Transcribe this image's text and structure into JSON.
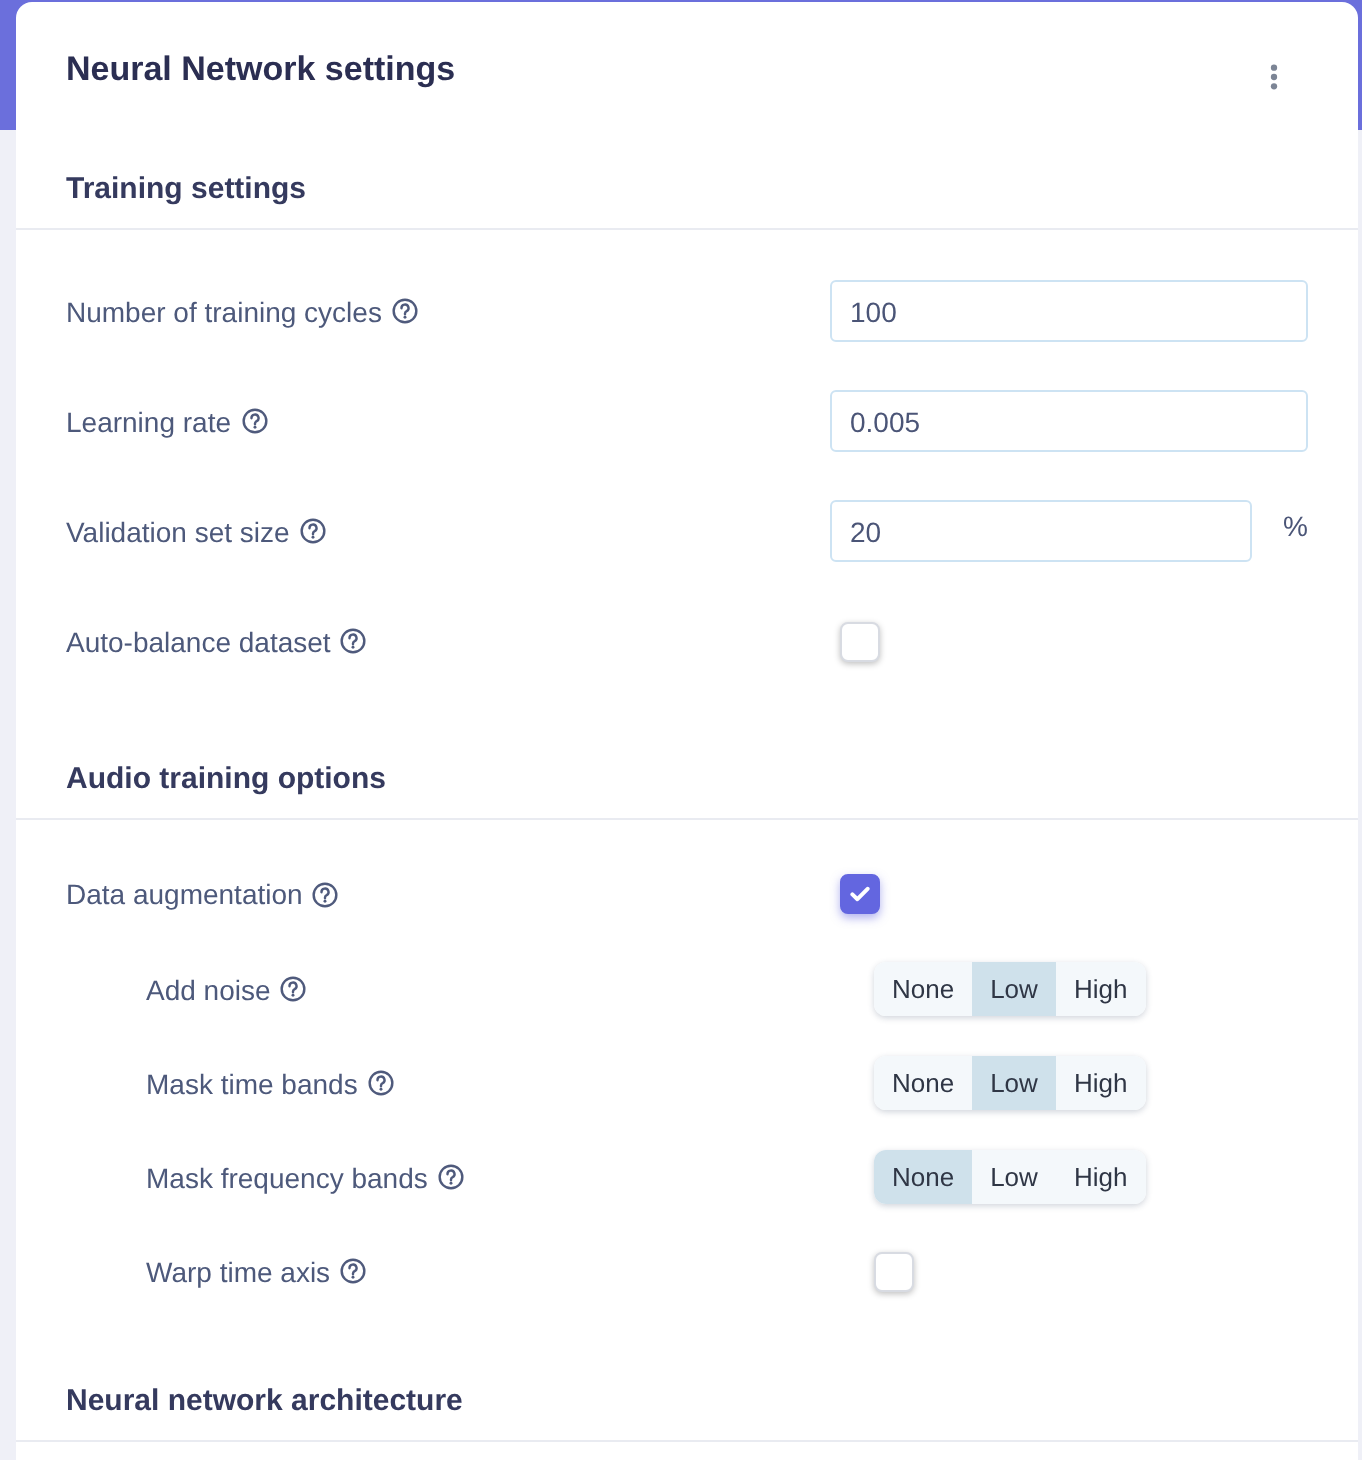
{
  "card": {
    "title": "Neural Network settings"
  },
  "sections": [
    {
      "title": "Training settings",
      "fields": [
        {
          "kind": "number",
          "label": "Number of training cycles",
          "value": "100"
        },
        {
          "kind": "number",
          "label": "Learning rate",
          "value": "0.005"
        },
        {
          "kind": "number",
          "label": "Validation set size",
          "value": "20",
          "unit": "%"
        },
        {
          "kind": "checkbox",
          "label": "Auto-balance dataset",
          "checked": false
        }
      ]
    },
    {
      "title": "Audio training options",
      "fields": [
        {
          "kind": "checkbox",
          "label": "Data augmentation",
          "checked": true,
          "children": [
            {
              "kind": "segmented",
              "label": "Add noise",
              "options": [
                {
                  "label": "None",
                  "selected": false
                },
                {
                  "label": "Low",
                  "selected": true
                },
                {
                  "label": "High",
                  "selected": false
                }
              ]
            },
            {
              "kind": "segmented",
              "label": "Mask time bands",
              "options": [
                {
                  "label": "None",
                  "selected": false
                },
                {
                  "label": "Low",
                  "selected": true
                },
                {
                  "label": "High",
                  "selected": false
                }
              ]
            },
            {
              "kind": "segmented",
              "label": "Mask frequency bands",
              "options": [
                {
                  "label": "None",
                  "selected": true
                },
                {
                  "label": "Low",
                  "selected": false
                },
                {
                  "label": "High",
                  "selected": false
                }
              ]
            },
            {
              "kind": "checkbox",
              "label": "Warp time axis",
              "checked": false
            }
          ]
        }
      ]
    },
    {
      "title": "Neural network architecture"
    }
  ]
}
